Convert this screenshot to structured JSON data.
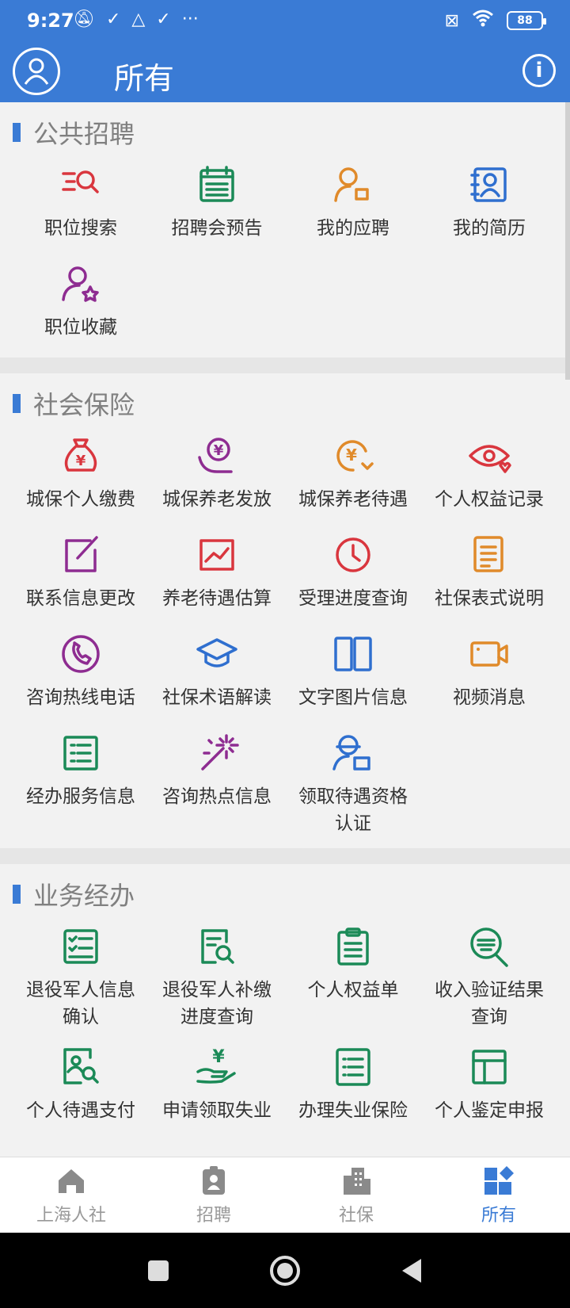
{
  "statusbar": {
    "time": "9:27",
    "battery": "88"
  },
  "header": {
    "title": "所有"
  },
  "colors": {
    "primary": "#3a7bd5",
    "red": "#d9363e",
    "green": "#1b8a57",
    "orange": "#e08a2a",
    "blue": "#2f6fcf",
    "purple": "#8e2c91"
  },
  "sections": [
    {
      "title": "公共招聘",
      "items": [
        {
          "label": "职位搜索",
          "icon": "search-list-icon",
          "color": "red"
        },
        {
          "label": "招聘会预告",
          "icon": "calendar-icon",
          "color": "green"
        },
        {
          "label": "我的应聘",
          "icon": "user-badge-icon",
          "color": "orange"
        },
        {
          "label": "我的简历",
          "icon": "resume-icon",
          "color": "blue"
        },
        {
          "label": "职位收藏",
          "icon": "user-star-icon",
          "color": "purple"
        }
      ]
    },
    {
      "title": "社会保险",
      "items": [
        {
          "label": "城保个人缴费",
          "icon": "money-bag-icon",
          "color": "red"
        },
        {
          "label": "城保养老发放",
          "icon": "hand-coin-icon",
          "color": "purple"
        },
        {
          "label": "城保养老待遇",
          "icon": "coin-cycle-icon",
          "color": "orange"
        },
        {
          "label": "个人权益记录",
          "icon": "eye-heart-icon",
          "color": "red"
        },
        {
          "label": "联系信息更改",
          "icon": "edit-icon",
          "color": "purple"
        },
        {
          "label": "养老待遇估算",
          "icon": "chart-icon",
          "color": "red"
        },
        {
          "label": "受理进度查询",
          "icon": "clock-icon",
          "color": "red"
        },
        {
          "label": "社保表式说明",
          "icon": "doc-lines-icon",
          "color": "orange"
        },
        {
          "label": "咨询热线电话",
          "icon": "phone-icon",
          "color": "purple"
        },
        {
          "label": "社保术语解读",
          "icon": "graduation-cap-icon",
          "color": "blue"
        },
        {
          "label": "文字图片信息",
          "icon": "book-icon",
          "color": "blue"
        },
        {
          "label": "视频消息",
          "icon": "video-icon",
          "color": "orange"
        },
        {
          "label": "经办服务信息",
          "icon": "list-icon",
          "color": "green"
        },
        {
          "label": "咨询热点信息",
          "icon": "magic-wand-icon",
          "color": "purple"
        },
        {
          "label": "领取待遇资格认证",
          "icon": "user-card-icon",
          "color": "blue"
        }
      ]
    },
    {
      "title": "业务经办",
      "items": [
        {
          "label": "退役军人信息确认",
          "icon": "checklist-icon",
          "color": "green"
        },
        {
          "label": "退役军人补缴进度查询",
          "icon": "doc-search-icon",
          "color": "green"
        },
        {
          "label": "个人权益单",
          "icon": "clipboard-icon",
          "color": "green"
        },
        {
          "label": "收入验证结果查询",
          "icon": "magnifier-icon",
          "color": "green"
        },
        {
          "label": "个人待遇支付",
          "icon": "person-doc-icon",
          "color": "green"
        },
        {
          "label": "申请领取失业",
          "icon": "hand-yen-icon",
          "color": "green"
        },
        {
          "label": "办理失业保险",
          "icon": "list-frame-icon",
          "color": "green"
        },
        {
          "label": "个人鉴定申报",
          "icon": "layout-icon",
          "color": "green"
        }
      ]
    }
  ],
  "bottom_nav": [
    {
      "label": "上海人社",
      "icon": "home-icon",
      "active": false
    },
    {
      "label": "招聘",
      "icon": "badge-icon",
      "active": false
    },
    {
      "label": "社保",
      "icon": "building-icon",
      "active": false
    },
    {
      "label": "所有",
      "icon": "apps-icon",
      "active": true
    }
  ]
}
